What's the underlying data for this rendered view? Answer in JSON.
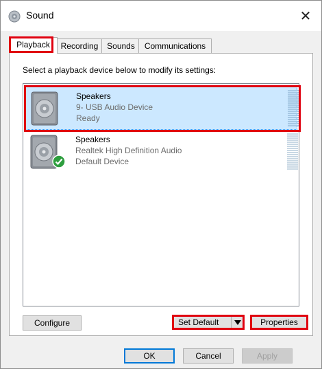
{
  "window": {
    "title": "Sound",
    "icon": "speaker-icon",
    "close_glyph": "✕"
  },
  "tabs": [
    {
      "label": "Playback",
      "active": true
    },
    {
      "label": "Recording",
      "active": false
    },
    {
      "label": "Sounds",
      "active": false
    },
    {
      "label": "Communications",
      "active": false
    }
  ],
  "panel": {
    "instruction": "Select a playback device below to modify its settings:"
  },
  "devices": [
    {
      "name": "Speakers",
      "description": "9- USB Audio Device",
      "status": "Ready",
      "selected": true,
      "default": false
    },
    {
      "name": "Speakers",
      "description": "Realtek High Definition Audio",
      "status": "Default Device",
      "selected": false,
      "default": true
    }
  ],
  "panel_buttons": {
    "configure": "Configure",
    "set_default": "Set Default",
    "properties": "Properties"
  },
  "dialog_buttons": {
    "ok": "OK",
    "cancel": "Cancel",
    "apply": "Apply"
  },
  "colors": {
    "selection": "#cce8ff",
    "highlight": "#e0000f",
    "accent": "#0078d7",
    "default_check": "#2e9e3e"
  }
}
